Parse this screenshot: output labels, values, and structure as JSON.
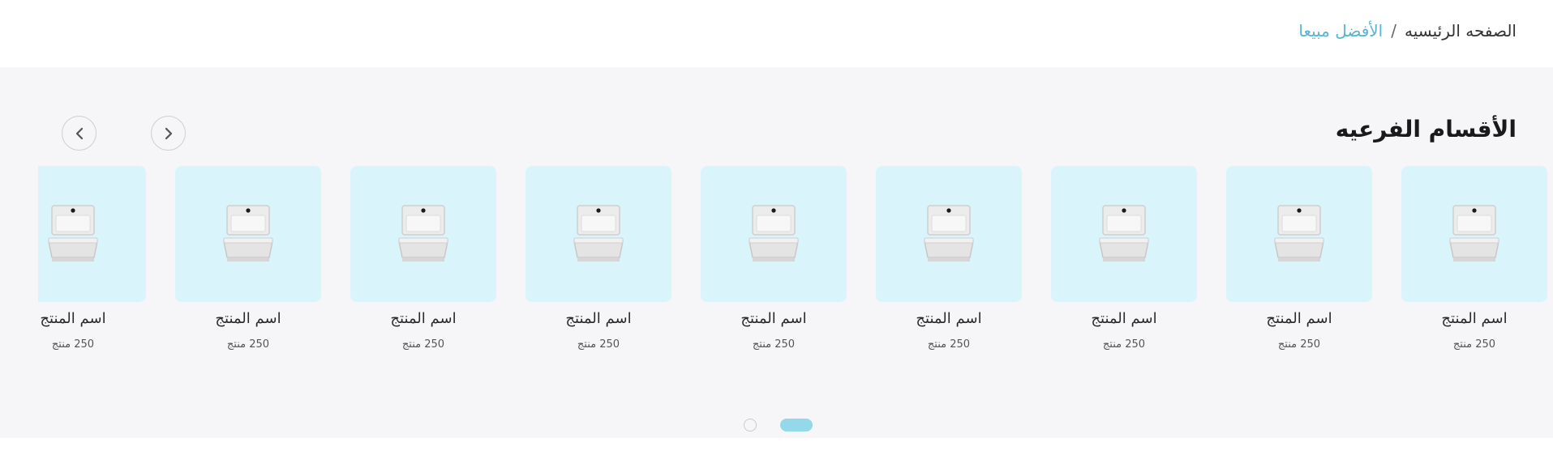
{
  "breadcrumb": {
    "home": "الصفحه الرئيسيه",
    "separator": "/",
    "current": "الأفضل مبيعا"
  },
  "section": {
    "title": "الأقسام الفرعيه"
  },
  "nav": {
    "prev_icon": "chevron-left-icon",
    "next_icon": "chevron-right-icon"
  },
  "cards": [
    {
      "name": "اسم المنتج",
      "count": "250 منتج"
    },
    {
      "name": "اسم المنتج",
      "count": "250 منتج"
    },
    {
      "name": "اسم المنتج",
      "count": "250 منتج"
    },
    {
      "name": "اسم المنتج",
      "count": "250 منتج"
    },
    {
      "name": "اسم المنتج",
      "count": "250 منتج"
    },
    {
      "name": "اسم المنتج",
      "count": "250 منتج"
    },
    {
      "name": "اسم المنتج",
      "count": "250 منتج"
    },
    {
      "name": "اسم المنتج",
      "count": "250 منتج"
    },
    {
      "name": "اسم المنتج",
      "count": "250 منتج"
    }
  ],
  "pagination": {
    "pages": 2,
    "active_index": 0
  },
  "colors": {
    "accent": "#5ab3d0",
    "card_bg": "#d9f4fb",
    "section_bg": "#f6f6f8",
    "active_dot": "#94d9ea"
  }
}
